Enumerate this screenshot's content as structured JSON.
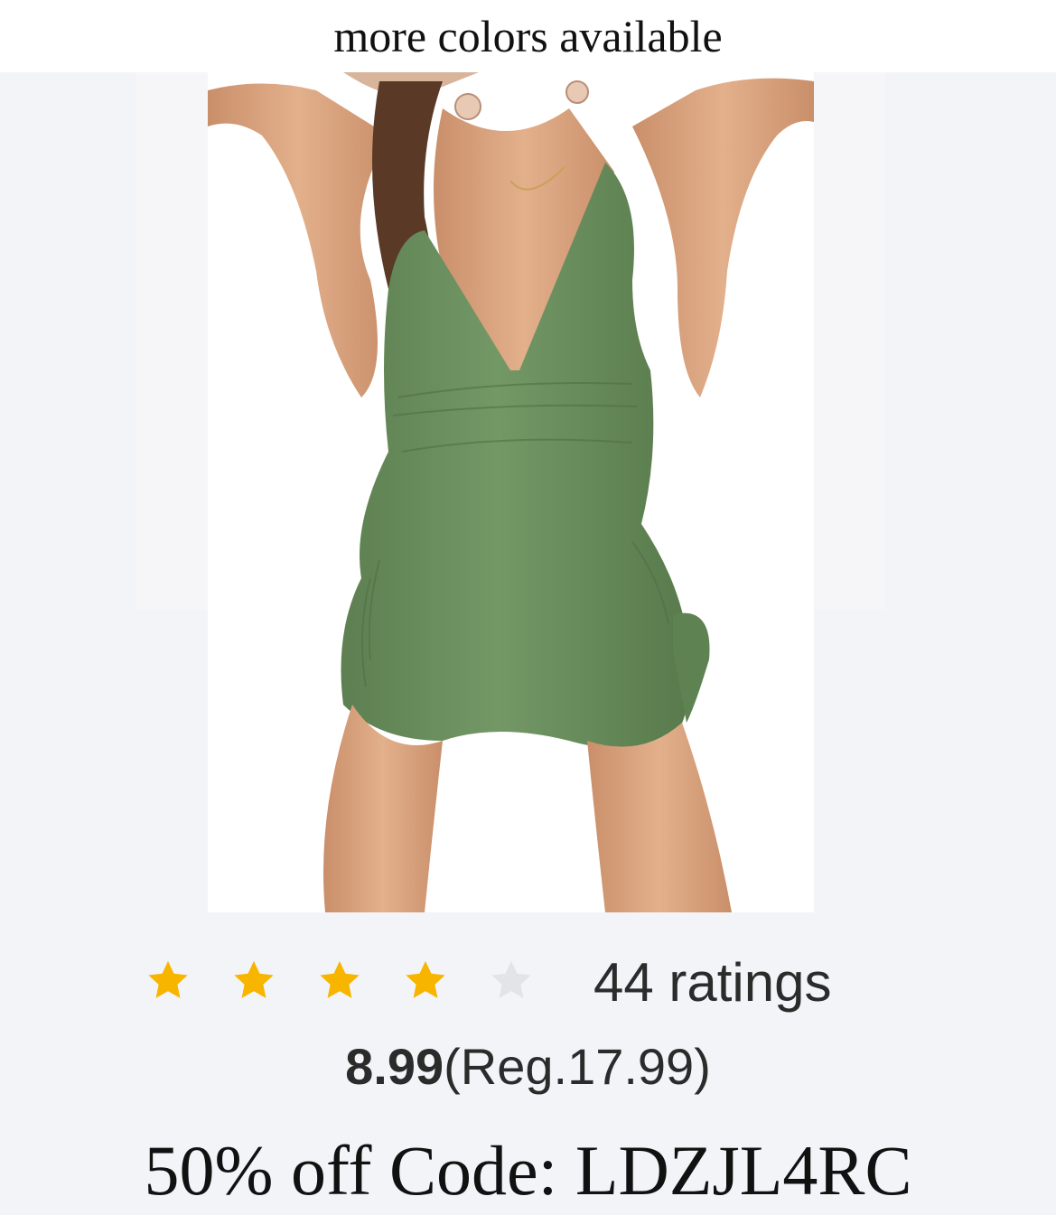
{
  "header": {
    "text": "more colors available"
  },
  "product_image": {
    "alt": "Green swim dress with side ruching and tie"
  },
  "rating": {
    "stars_filled": 4,
    "stars_total": 5,
    "count_text": "44 ratings"
  },
  "price": {
    "sale": "8.99",
    "regular": "(Reg.17.99)"
  },
  "promo": {
    "text": "50% off Code: LDZJL4RC"
  },
  "colors": {
    "star_filled": "#f7b500",
    "star_empty": "#e3e4e8",
    "dress_green": "#6b8f5e",
    "skin": "#d9a580",
    "hair": "#5a3a26"
  }
}
